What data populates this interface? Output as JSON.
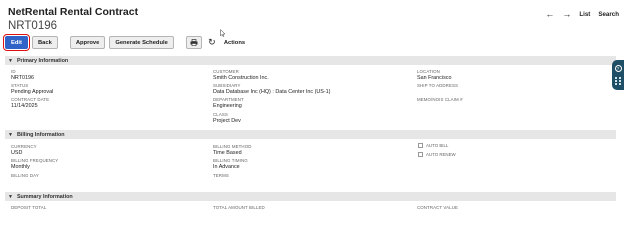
{
  "header": {
    "title": "NetRental Rental Contract",
    "record_id": "NRT0196"
  },
  "topnav": {
    "back_arrow": "←",
    "forward_arrow": "→",
    "list_label": "List",
    "search_label": "Search"
  },
  "toolbar": {
    "edit_label": "Edit",
    "back_label": "Back",
    "approve_label": "Approve",
    "generate_schedule_label": "Generate Schedule",
    "actions_label": "Actions"
  },
  "sections": {
    "primary": {
      "title": "Primary Information"
    },
    "billing": {
      "title": "Billing Information"
    },
    "summary": {
      "title": "Summary Information"
    }
  },
  "primary_fields": {
    "id_label": "ID",
    "id_value": "NRT0196",
    "status_label": "STATUS",
    "status_value": "Pending Approval",
    "contract_date_label": "CONTRACT DATE",
    "contract_date_value": "11/14/2025",
    "customer_label": "CUSTOMER",
    "customer_value": "Smith Construction Inc.",
    "subsidiary_label": "SUBSIDIARY",
    "subsidiary_value": "Data Database Inc (HQ) : Data Center Inc (US-1)",
    "department_label": "DEPARTMENT",
    "department_value": "Engineering",
    "class_label": "CLASS",
    "class_value": "Project Dev",
    "location_label": "LOCATION",
    "location_value": "San Francisco",
    "ship_to_label": "SHIP TO ADDRESS",
    "memo_label": "MEMO/NOIS CLAIM #"
  },
  "billing_fields": {
    "currency_label": "CURRENCY",
    "currency_value": "USD",
    "frequency_label": "BILLING FREQUENCY",
    "frequency_value": "Monthly",
    "billing_day_label": "BILLING DAY",
    "method_label": "BILLING METHOD",
    "method_value": "Time Based",
    "timing_label": "BILLING TIMING",
    "timing_value": "In Advance",
    "terms_label": "TERMS",
    "auto_bill_label": "AUTO BILL",
    "auto_renew_label": "AUTO RENEW"
  },
  "summary_fields": {
    "deposit_label": "DEPOSIT TOTAL",
    "total_billed_label": "TOTAL AMOUNT BILLED",
    "contract_value_label": "CONTRACT VALUE"
  }
}
